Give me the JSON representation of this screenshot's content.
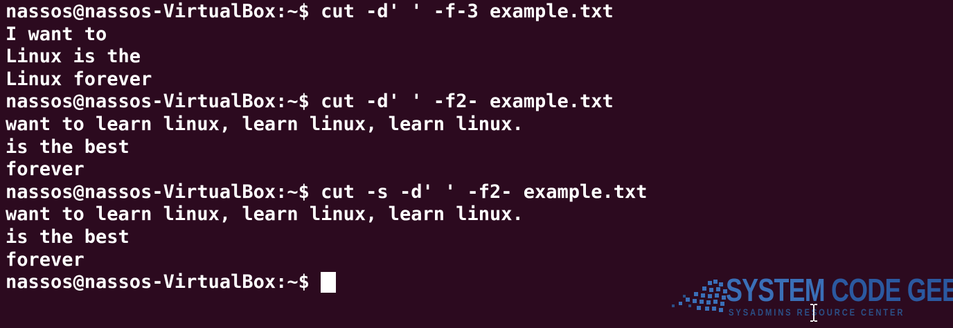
{
  "terminal": {
    "prompt": "nassos@nassos-VirtualBox:~$ ",
    "lines": [
      {
        "prompt": "nassos@nassos-VirtualBox:~$ ",
        "text": "cut -d' ' -f-3 example.txt"
      },
      {
        "prompt": "",
        "text": "I want to"
      },
      {
        "prompt": "",
        "text": "Linux is the"
      },
      {
        "prompt": "",
        "text": "Linux forever"
      },
      {
        "prompt": "nassos@nassos-VirtualBox:~$ ",
        "text": "cut -d' ' -f2- example.txt"
      },
      {
        "prompt": "",
        "text": "want to learn linux, learn linux, learn linux."
      },
      {
        "prompt": "",
        "text": "is the best"
      },
      {
        "prompt": "",
        "text": "forever"
      },
      {
        "prompt": "nassos@nassos-VirtualBox:~$ ",
        "text": "cut -s -d' ' -f2- example.txt"
      },
      {
        "prompt": "",
        "text": "want to learn linux, learn linux, learn linux."
      },
      {
        "prompt": "",
        "text": "is the best"
      },
      {
        "prompt": "",
        "text": "forever"
      }
    ],
    "colors": {
      "background": "#2c0a1f",
      "text": "#ffffff",
      "cursor": "#ffffff"
    }
  },
  "watermark": {
    "title_part1": "SYSTEM",
    "title_part2": " CODE GEEKS",
    "subtitle": "SYSADMINS RESOURCE CENTER",
    "colors": {
      "primary": "#3a6fb7",
      "secondary": "#2b59a0"
    }
  },
  "icons": {
    "mouse_cursor": "i-beam-cursor-icon",
    "logo": "system-code-geeks-logo"
  }
}
